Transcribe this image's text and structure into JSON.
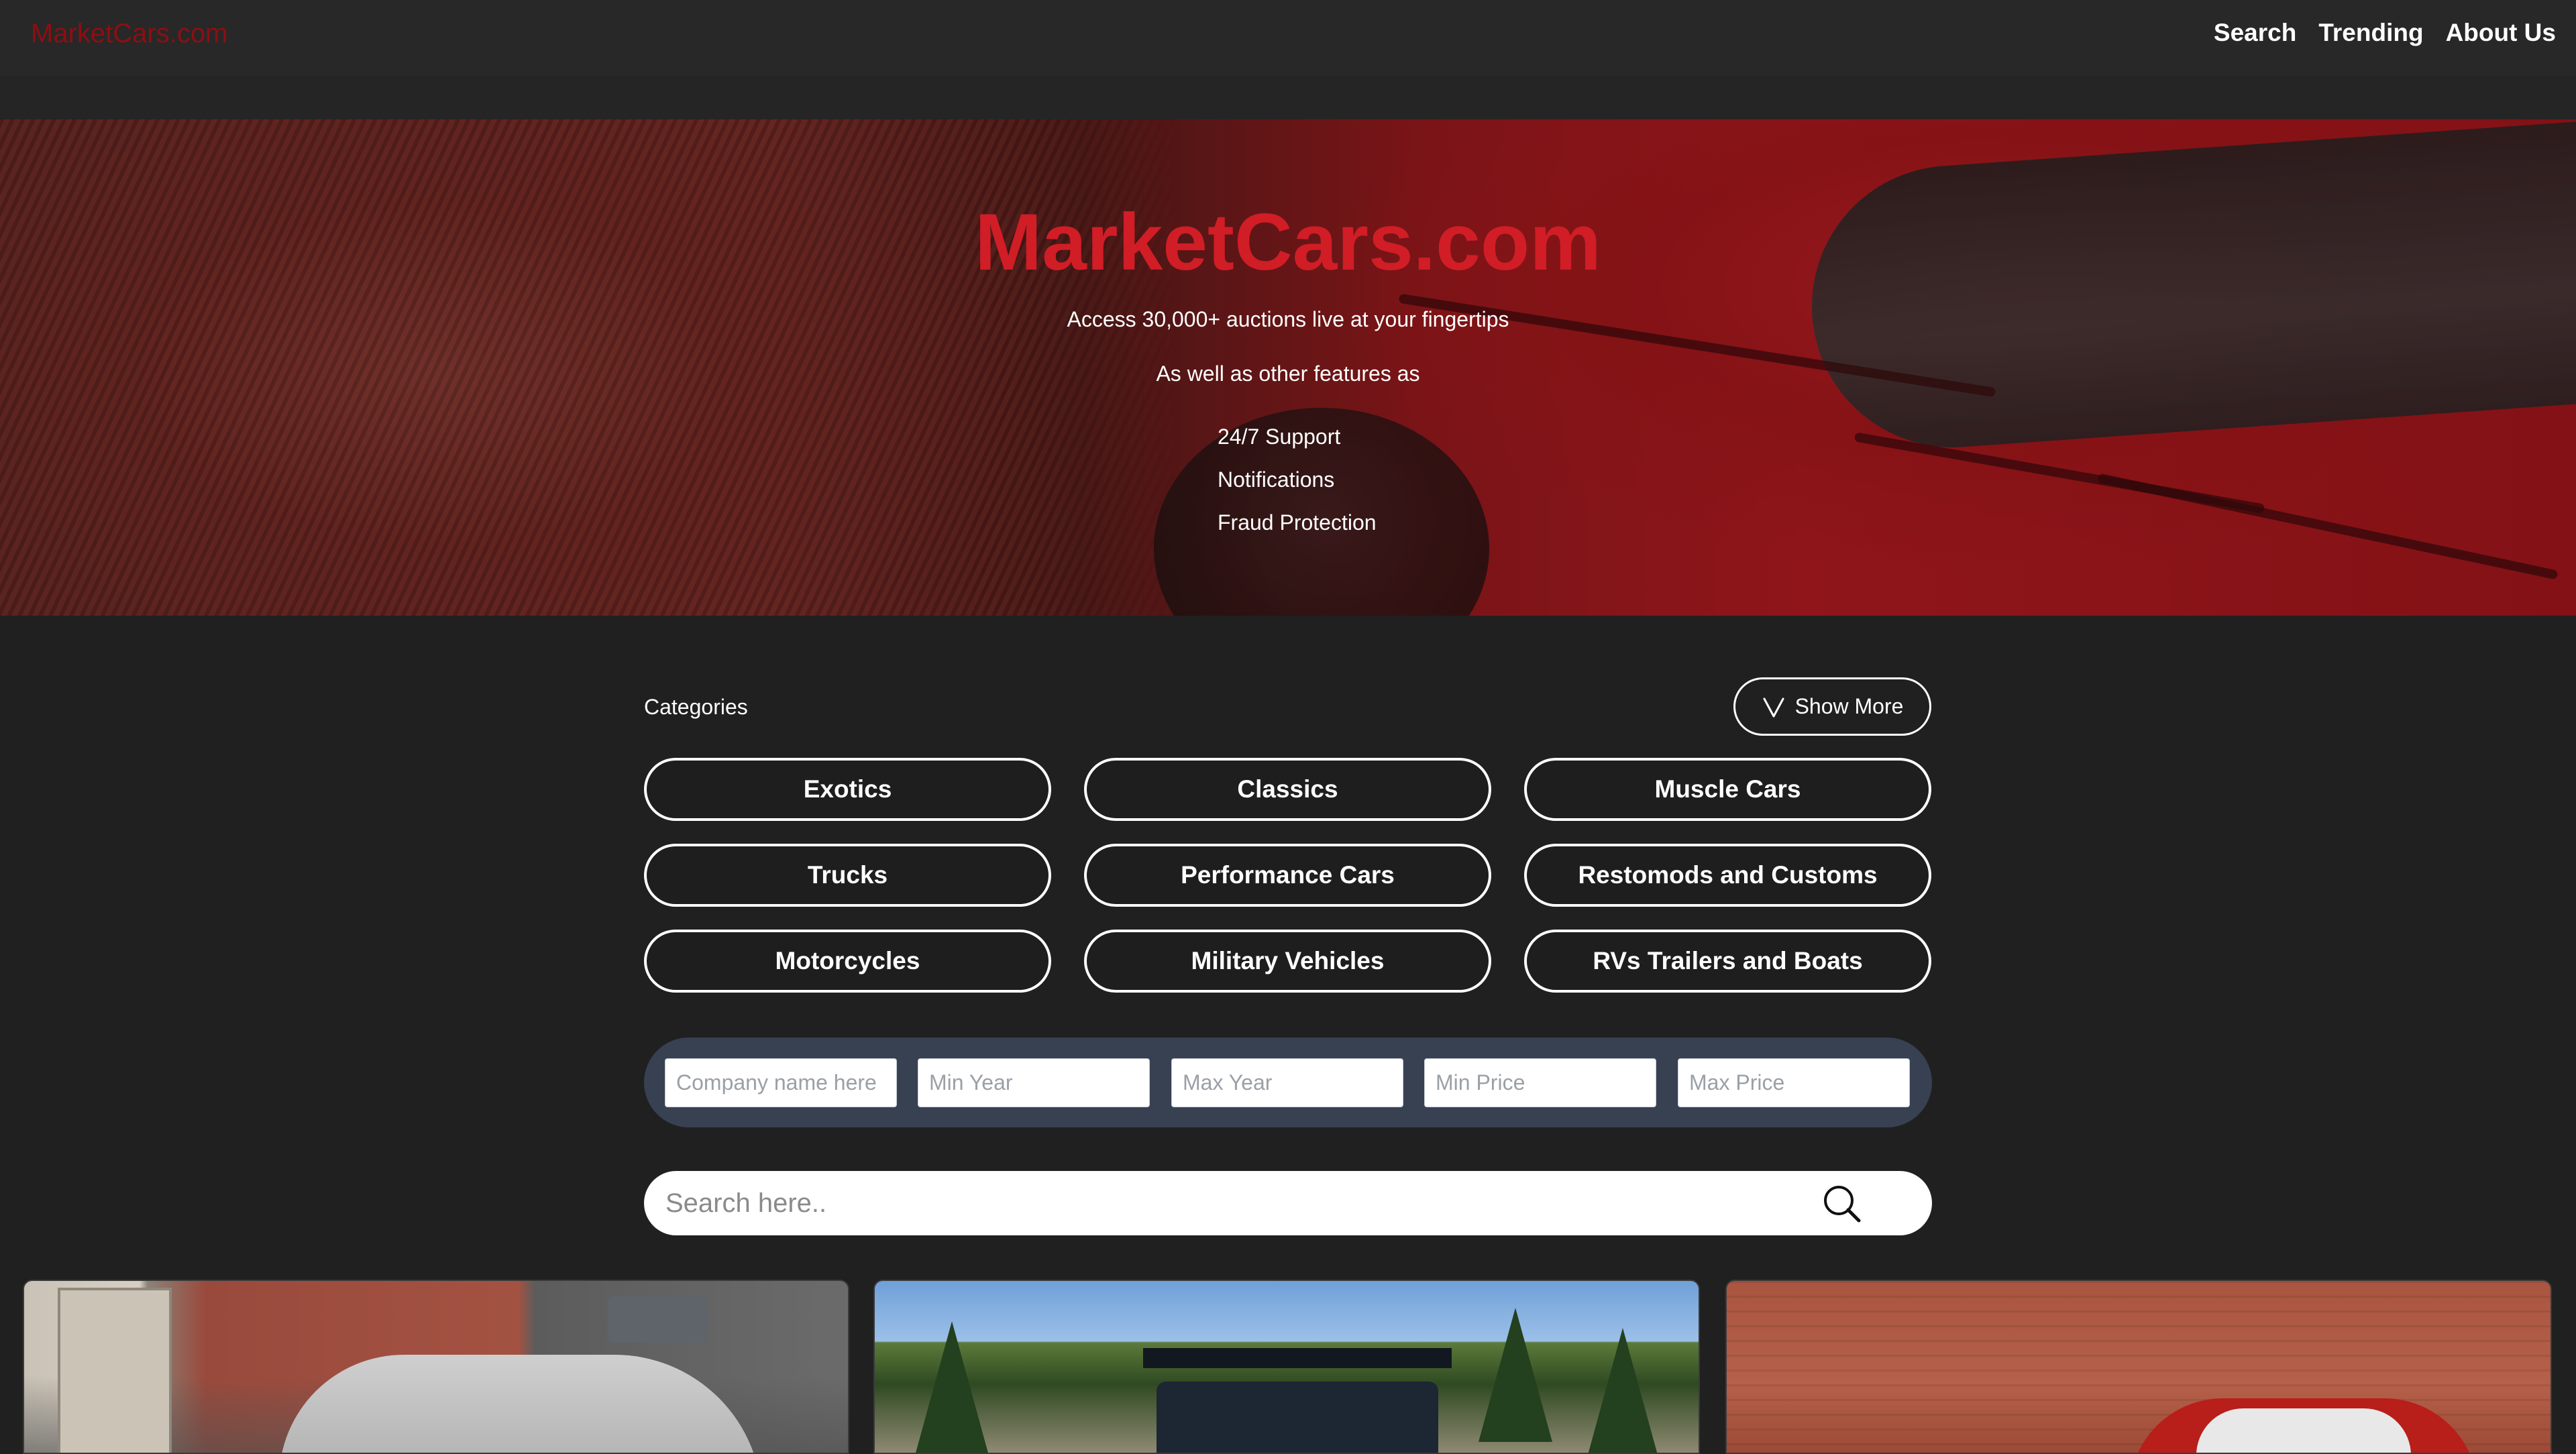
{
  "nav": {
    "brand": "MarketCars.com",
    "links": [
      "Search",
      "Trending",
      "About Us"
    ]
  },
  "hero": {
    "title": "MarketCars.com",
    "tagline": "Access 30,000+ auctions live at your fingertips",
    "subtitle": "As well as other features as",
    "features": [
      "24/7 Support",
      "Notifications",
      "Fraud Protection"
    ]
  },
  "categories": {
    "label": "Categories",
    "show_more": "Show More",
    "items": [
      "Exotics",
      "Classics",
      "Muscle Cars",
      "Trucks",
      "Performance Cars",
      "Restomods and Customs",
      "Motorcycles",
      "Military Vehicles",
      "RVs Trailers and Boats"
    ]
  },
  "filters": {
    "company_placeholder": "Company name here",
    "min_year_placeholder": "Min Year",
    "max_year_placeholder": "Max Year",
    "min_price_placeholder": "Min Price",
    "max_price_placeholder": "Max Price"
  },
  "search": {
    "placeholder": "Search here.."
  },
  "colors": {
    "brand": "#d11d26",
    "nav_brand": "#8e0e12",
    "background": "#202020",
    "filter_bar": "#384152"
  },
  "icons": {
    "show_more": "chevron-down-icon",
    "search": "search-icon"
  }
}
